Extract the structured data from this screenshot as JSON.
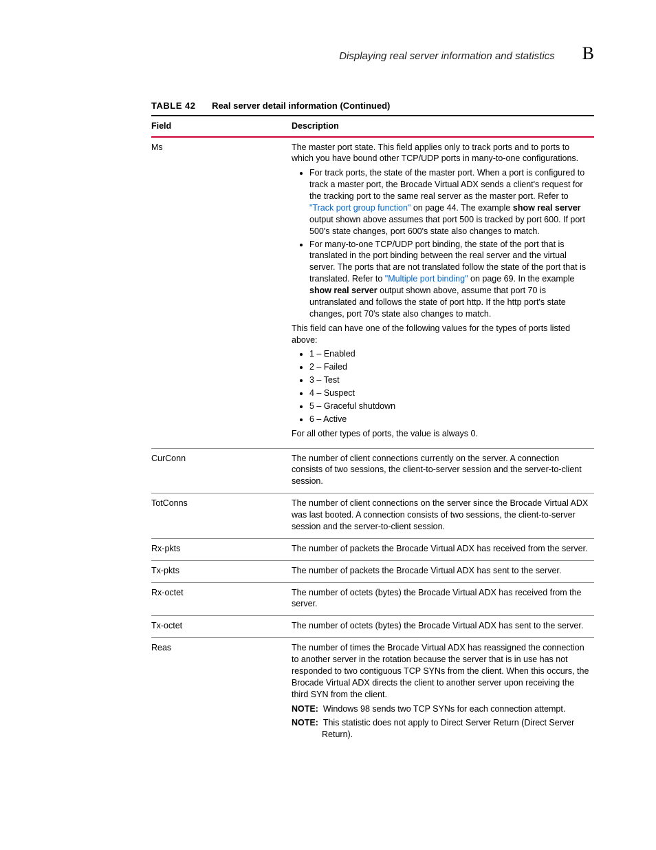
{
  "header": {
    "title": "Displaying real server information and statistics",
    "letter": "B"
  },
  "table": {
    "number": "TABLE 42",
    "title": "Real server detail information  (Continued)",
    "col_field": "Field",
    "col_desc": "Description"
  },
  "rows": {
    "ms": {
      "field": "Ms",
      "p1": "The master port state. This field applies only to track ports and to ports to which you have bound other TCP/UDP ports in many-to-one configurations.",
      "b1_pre": "For track ports, the state of the master port. When a port is configured to track a master port, the Brocade Virtual ADX sends a client's request for the tracking port to the same real server as the master port. Refer to ",
      "b1_link": "\"Track port group function\"",
      "b1_post_link": " on page 44. The example ",
      "b1_bold": "show real server",
      "b1_end": " output shown above assumes that port 500 is tracked by port 600. If port 500's state changes, port 600's state also changes to match.",
      "b2_pre": "For many-to-one TCP/UDP port binding, the state of the port that is translated in the port binding between the real server and the virtual server. The ports that are not translated follow the state of the port that is translated. Refer to ",
      "b2_link": "\"Multiple port binding\"",
      "b2_post_link": " on page 69. In the example ",
      "b2_bold": "show real server",
      "b2_end": " output shown above, assume that port 70 is untranslated and follows the state of port http. If the http port's state changes, port 70's state also changes to match.",
      "p2": "This field can have one of the following values for the types of ports listed above:",
      "v1": "1 – Enabled",
      "v2": "2 – Failed",
      "v3": "3 – Test",
      "v4": "4 – Suspect",
      "v5": "5 – Graceful shutdown",
      "v6": "6 – Active",
      "p3": "For all other types of ports, the value is always 0."
    },
    "curconn": {
      "field": "CurConn",
      "desc": "The number of client connections currently on the server. A connection consists of two sessions, the client-to-server session and the server-to-client session."
    },
    "totconns": {
      "field": "TotConns",
      "desc": "The number of client connections on the server since the Brocade Virtual ADX was last booted. A connection consists of two sessions, the client-to-server session and the server-to-client session."
    },
    "rxpkts": {
      "field": "Rx-pkts",
      "desc": "The number of packets the Brocade Virtual ADX has received from the server."
    },
    "txpkts": {
      "field": "Tx-pkts",
      "desc": "The number of packets the Brocade Virtual ADX has sent to the server."
    },
    "rxoctet": {
      "field": "Rx-octet",
      "desc": "The number of octets (bytes) the Brocade Virtual ADX has received from the server."
    },
    "txoctet": {
      "field": "Tx-octet",
      "desc": "The number of octets (bytes) the Brocade Virtual ADX has sent to the server."
    },
    "reas": {
      "field": "Reas",
      "p1": "The number of times the Brocade Virtual ADX has reassigned the connection to another server in the rotation because the server that is in use has not responded to two contiguous TCP SYNs from the client. When this occurs, the Brocade Virtual ADX directs the client to another server upon receiving the third SYN from the client.",
      "note1_label": "NOTE:",
      "note1_text": "Windows 98 sends two TCP SYNs for each connection attempt.",
      "note2_label": "NOTE:",
      "note2_text": "This statistic does not apply to Direct Server Return (Direct Server Return)."
    }
  }
}
